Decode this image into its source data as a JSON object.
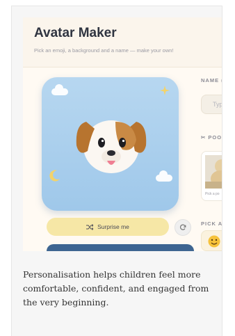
{
  "app": {
    "title": "Avatar Maker",
    "subtitle": "Pick an emoji, a background and a name — make your own!"
  },
  "avatar": {
    "emoji": "puppy-dog-emoji",
    "background_color": "#a9cff0"
  },
  "buttons": {
    "surprise_label": "Surprise me",
    "surprise_icon": "shuffle-icon",
    "refresh_icon": "refresh-icon"
  },
  "side_panel": {
    "name_label": "NAME (C",
    "name_placeholder": "Type",
    "poodle_label": "POOD",
    "poodle_icon": "scissors-icon",
    "photo_caption": "Pick a po",
    "pick_label": "PICK AN"
  },
  "caption": "Personalisation helps children feel more comfortable, confident, and engaged from the very beginning.",
  "colors": {
    "accent_yellow": "#f6e7a6",
    "accent_blue": "#3e6591"
  }
}
